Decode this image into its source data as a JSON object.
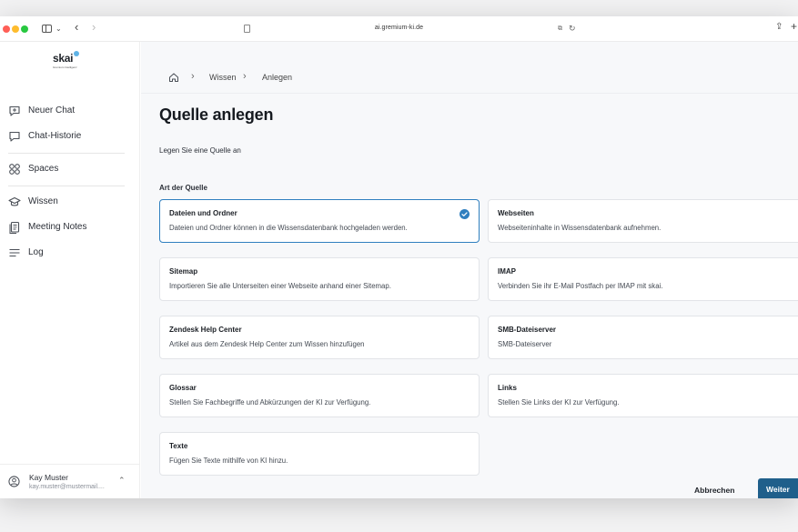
{
  "browser": {
    "url": "ai.gremium-ki.de"
  },
  "sidebar": {
    "logo_word": "skai",
    "logo_tagline": "Gremium Intelligenz",
    "items": [
      {
        "label": "Neuer Chat",
        "icon": "chat-plus-icon"
      },
      {
        "label": "Chat-Historie",
        "icon": "chat-bubble-icon"
      },
      {
        "label": "Spaces",
        "icon": "grid-icon"
      },
      {
        "label": "Wissen",
        "icon": "graduation-cap-icon"
      },
      {
        "label": "Meeting Notes",
        "icon": "notes-icon"
      },
      {
        "label": "Log",
        "icon": "list-icon"
      }
    ],
    "user": {
      "name": "Kay Muster",
      "email": "kay.muster@mustermail...."
    }
  },
  "breadcrumb": {
    "items": [
      "Wissen",
      "Anlegen"
    ]
  },
  "page": {
    "title": "Quelle anlegen",
    "subtitle": "Legen Sie eine Quelle an",
    "section_label": "Art der Quelle"
  },
  "sources": [
    {
      "title": "Dateien und Ordner",
      "desc": "Dateien und Ordner können in die Wissensdatenbank hochgeladen werden.",
      "selected": true
    },
    {
      "title": "Webseiten",
      "desc": "Webseiteninhalte in Wissensdatenbank aufnehmen.",
      "selected": false
    },
    {
      "title": "Sitemap",
      "desc": "Importieren Sie alle Unterseiten einer Webseite anhand einer Sitemap.",
      "selected": false
    },
    {
      "title": "IMAP",
      "desc": "Verbinden Sie ihr E-Mail Postfach per IMAP mit skai.",
      "selected": false
    },
    {
      "title": "Zendesk Help Center",
      "desc": "Artikel aus dem Zendesk Help Center zum Wissen hinzufügen",
      "selected": false
    },
    {
      "title": "SMB-Dateiserver",
      "desc": "SMB-Dateiserver",
      "selected": false
    },
    {
      "title": "Glossar",
      "desc": "Stellen Sie Fachbegriffe und Abkürzungen der KI zur Verfügung.",
      "selected": false
    },
    {
      "title": "Links",
      "desc": "Stellen Sie Links der KI zur Verfügung.",
      "selected": false
    },
    {
      "title": "Texte",
      "desc": "Fügen Sie Texte mithilfe von KI hinzu.",
      "selected": false
    }
  ],
  "actions": {
    "cancel_label": "Abbrechen",
    "next_label": "Weiter"
  },
  "colors": {
    "accent": "#2f7fbf",
    "primary_button": "#1f5f8b"
  }
}
